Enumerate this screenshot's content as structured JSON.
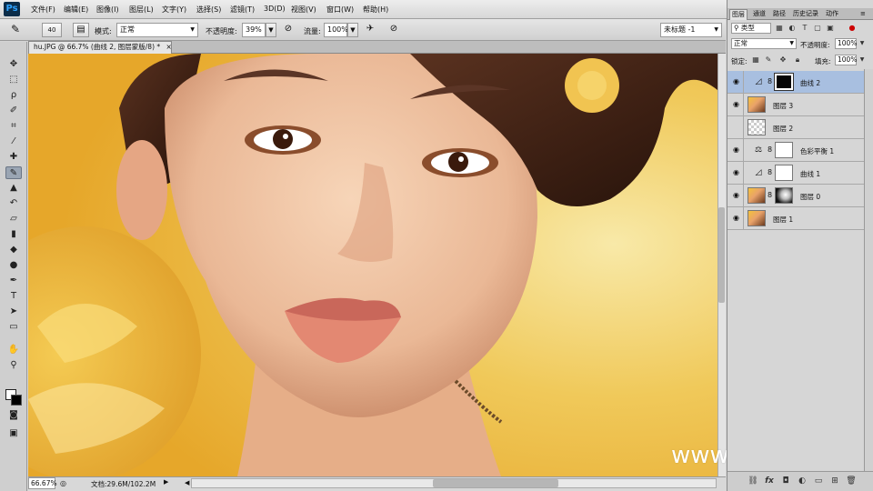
{
  "app": {
    "logo": "Ps"
  },
  "menu": [
    "文件(F)",
    "编辑(E)",
    "图像(I)",
    "图层(L)",
    "文字(Y)",
    "选择(S)",
    "滤镜(T)",
    "3D(D)",
    "视图(V)",
    "窗口(W)",
    "帮助(H)"
  ],
  "window_controls": {
    "minimize": "–",
    "restore": "□",
    "close": "✕"
  },
  "options": {
    "brush_size": "40",
    "mode_label": "模式:",
    "mode_value": "正常",
    "opacity_label": "不透明度:",
    "opacity_value": "39%",
    "flow_label": "流量:",
    "flow_value": "100%",
    "workspace": "未标题 -1"
  },
  "document": {
    "tab_title": "hu.JPG @ 66.7% (曲线 2, 图层蒙版/8) *",
    "tab_close": "×",
    "zoom": "66.67%",
    "info": "文档:29.6M/102.2M"
  },
  "panel": {
    "tabs": [
      "图层",
      "通道",
      "路径",
      "历史记录",
      "动作"
    ],
    "filter_kind": "类型",
    "blend_mode": "正常",
    "opacity_label": "不透明度:",
    "opacity_value": "100%",
    "lock_label": "锁定:",
    "fill_label": "填充:",
    "fill_value": "100%"
  },
  "layers": [
    {
      "name": "曲线 2",
      "kind": "adjustment",
      "adj_icon": "curves-icon",
      "mask": "black",
      "selected": true
    },
    {
      "name": "图层 3",
      "kind": "pixel",
      "thumb": "photo",
      "selected": false
    },
    {
      "name": "图层 2",
      "kind": "pixel",
      "thumb": "transparent",
      "selected": false
    },
    {
      "name": "色彩平衡 1",
      "kind": "adjustment",
      "adj_icon": "balance-icon",
      "mask": "white",
      "selected": false
    },
    {
      "name": "曲线 1",
      "kind": "adjustment",
      "adj_icon": "curves-icon",
      "mask": "white",
      "selected": false
    },
    {
      "name": "图层 0",
      "kind": "pixel",
      "thumb": "photo",
      "mask": "portrait-mask",
      "selected": false
    },
    {
      "name": "图层 1",
      "kind": "pixel",
      "thumb": "photo",
      "selected": false
    }
  ],
  "watermark": "www.hunls.com",
  "colors": {
    "canvas_bg": "#f0c95a",
    "selected_layer": "#a8bfe0",
    "close_button": "#c0392b"
  }
}
